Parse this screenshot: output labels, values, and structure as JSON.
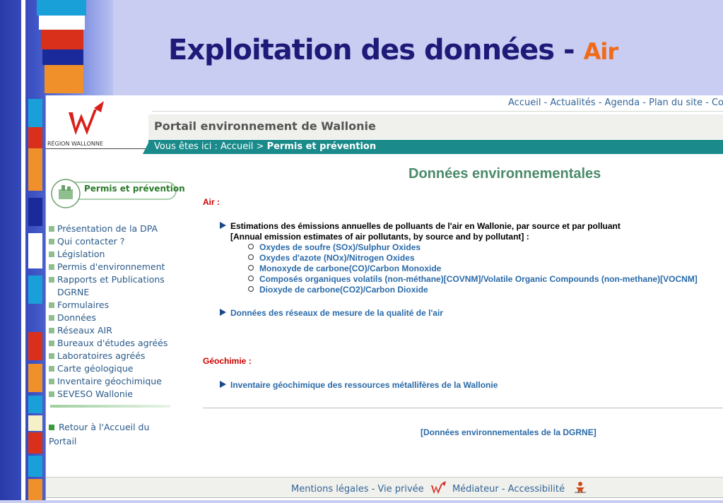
{
  "slide": {
    "title_main": "Exploitation des données - ",
    "title_accent": "Air",
    "colors": {
      "title": "#1d1a78",
      "accent": "#f06a1a",
      "background": "#c9cdf2"
    }
  },
  "site": {
    "top_nav": "Accueil - Actualités - Agenda - Plan du site - Co",
    "logo_text": "RÉGION WALLONNE",
    "portal_title": "Portail environnement de Wallonie",
    "breadcrumb": {
      "prefix": "Vous êtes ici : Accueil > ",
      "current": "Permis et prévention"
    },
    "section_badge": "Permis et prévention",
    "sidebar": {
      "items": [
        "Présentation de la DPA",
        "Qui contacter ?",
        "Législation",
        "Permis d'environnement",
        "Rapports et Publications DGRNE",
        "Formulaires",
        "Données",
        "Réseaux AIR",
        "Bureaux d'études agréés",
        "Laboratoires agréés",
        "Carte géologique",
        "Inventaire géochimique",
        "SEVESO Wallonie"
      ],
      "back_link": "Retour à l'Accueil du Portail"
    },
    "main": {
      "title": "Données environnementales",
      "air_label": "Air :",
      "estimations_line1": "Estimations des émissions annuelles de polluants de l'air en Wallonie, par source et par polluant",
      "estimations_line2": "[Annual emission estimates of air pollutants, by source and by pollutant] :",
      "pollutants": [
        "Oxydes de soufre (SOx)/Sulphur Oxides",
        "Oxydes d'azote (NOx)/Nitrogen Oxides",
        "Monoxyde de carbone(CO)/Carbon Monoxide",
        "Composés organiques volatils (non-méthane)[COVNM]/Volatile Organic Compounds (non-methane)[VOCNM]",
        "Dioxyde de carbone(CO2)/Carbon Dioxide"
      ],
      "air_networks_link": "Données des réseaux de mesure de la qualité de l'air",
      "geochem_label": "Géochimie :",
      "geochem_link": "Inventaire géochimique des ressources métallifères de la Wallonie",
      "dgrne_link": "[Données environnementales de la DGRNE]"
    },
    "footer": {
      "legal": "Mentions légales - Vie privée",
      "mediator": "Médiateur - Accessibilité"
    },
    "colors": {
      "breadcrumb_bg": "#1a8a8a",
      "link": "#2a6aa8",
      "section_label": "#cc0000"
    }
  }
}
